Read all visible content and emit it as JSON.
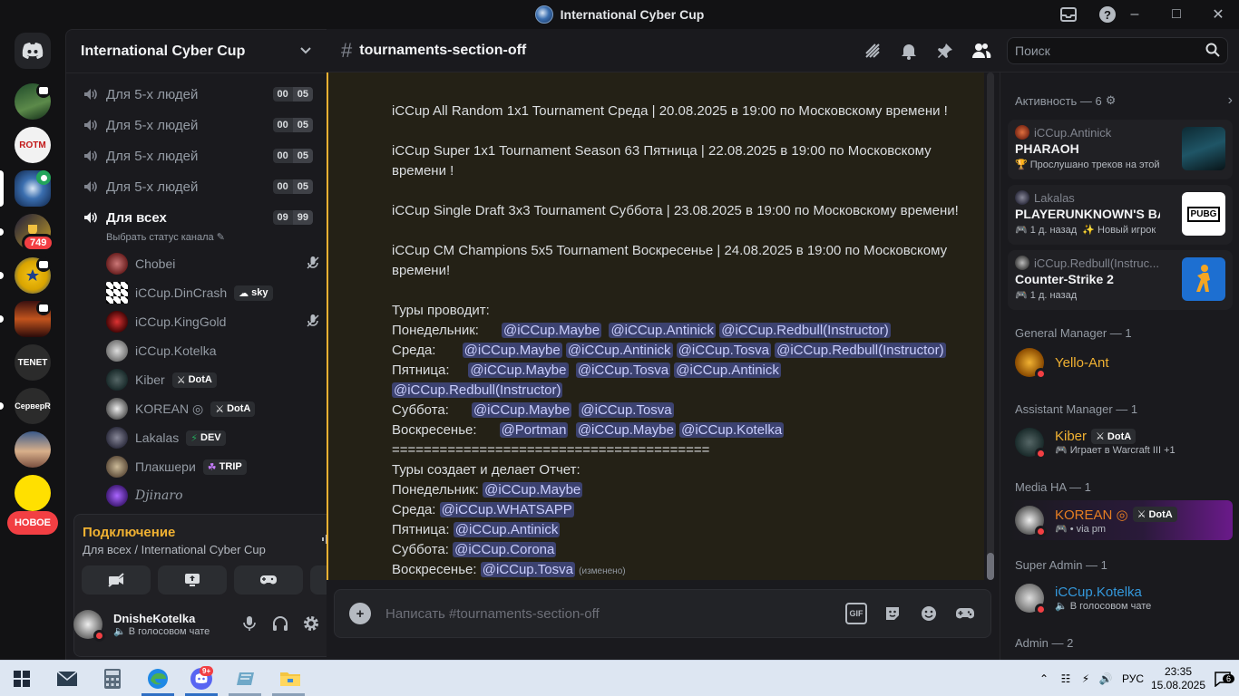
{
  "window": {
    "title": "International Cyber Cup"
  },
  "guilds": {
    "badge_count": "749",
    "new_label": "НОВОЕ",
    "labels": {
      "rotm": "ROTM",
      "tenet": "TENET",
      "serverr": "СерверR"
    }
  },
  "server": {
    "name": "International Cyber Cup"
  },
  "voice_channels": [
    {
      "name": "Для 5-х людей",
      "current": "00",
      "limit": "05"
    },
    {
      "name": "Для 5-х людей",
      "current": "00",
      "limit": "05"
    },
    {
      "name": "Для 5-х людей",
      "current": "00",
      "limit": "05"
    },
    {
      "name": "Для 5-х людей",
      "current": "00",
      "limit": "05"
    },
    {
      "name": "Для всех",
      "current": "09",
      "limit": "99"
    }
  ],
  "channel_status_prompt": "Выбрать статус канала",
  "voice_users": [
    {
      "name": "Chobei",
      "tag": "",
      "muted": true
    },
    {
      "name": "iCCup.DinCrash",
      "tag": "sky",
      "muted": false
    },
    {
      "name": "iCCup.KingGold",
      "tag": "",
      "muted": true
    },
    {
      "name": "iCCup.Kotelka",
      "tag": "",
      "muted": false
    },
    {
      "name": "Kiber",
      "tag": "DotA",
      "muted": false
    },
    {
      "name": "KOREAN ◎",
      "tag": "DotA",
      "muted": false
    },
    {
      "name": "Lakalas",
      "tag": "DEV",
      "muted": false
    },
    {
      "name": "Плакшери",
      "tag": "TRIP",
      "muted": false
    },
    {
      "name": "Djinaro",
      "tag": "",
      "muted": false
    }
  ],
  "voice_panel": {
    "status": "Подключение",
    "location": "Для всех / International Cyber Cup"
  },
  "user_panel": {
    "name": "DnisheKotelka",
    "status": "В голосовом чате"
  },
  "channel": {
    "name": "tournaments-section-off",
    "composer_placeholder": "Написать #tournaments-section-off"
  },
  "search": {
    "placeholder": "Поиск"
  },
  "message": {
    "tournaments": [
      "iCCup All Random 1x1 Tournament Среда | 20.08.2025 в 19:00 по Московскому времени !",
      "iCCup Super 1x1 Tournament Season 63 Пятница | 22.08.2025 в 19:00 по Московскому",
      "времени !",
      "iCCup Single Draft 3x3 Tournament Суббота | 23.08.2025 в 19:00 по Московскому времени!",
      "iCCup CM Champions 5x5 Tournament Воскресенье | 24.08.2025 в 19:00 по Московскому",
      "времени!"
    ],
    "hosts_title": "Туры проводит:",
    "hosts": [
      {
        "day": "Понедельник:",
        "mentions": [
          "@iCCup.Maybe",
          "@iCCup.Antinick",
          "@iCCup.Redbull(Instructor)"
        ]
      },
      {
        "day": "Среда:",
        "mentions": [
          "@iCCup.Maybe",
          "@iCCup.Antinick",
          "@iCCup.Tosva",
          "@iCCup.Redbull(Instructor)"
        ]
      },
      {
        "day": "Пятница:",
        "mentions": [
          "@iCCup.Maybe",
          "@iCCup.Tosva",
          "@iCCup.Antinick"
        ]
      },
      {
        "day": "",
        "mentions": [
          "@iCCup.Redbull(Instructor)"
        ]
      },
      {
        "day": "Суббота:",
        "mentions": [
          "@iCCup.Maybe",
          "@iCCup.Tosva"
        ]
      },
      {
        "day": "Воскресенье:",
        "mentions": [
          "@Portman",
          "@iCCup.Maybe",
          "@iCCup.Kotelka"
        ]
      }
    ],
    "separator": "========================================",
    "reports_title": "Туры создает и делает Отчет:",
    "reports": [
      {
        "day": "Понедельник:",
        "mention": "@iCCup.Maybe"
      },
      {
        "day": "Среда:",
        "mention": "@iCCup.WHATSAPP"
      },
      {
        "day": "Пятница:",
        "mention": "@iCCup.Antinick"
      },
      {
        "day": "Суббота:",
        "mention": "@iCCup.Corona"
      },
      {
        "day": "Воскресенье:",
        "mention": "@iCCup.Tosva"
      }
    ],
    "edited": "(изменено)"
  },
  "activity": {
    "title": "Активность — 6",
    "cards": [
      {
        "user": "iCCup.Antinick",
        "game": "PHARAOH",
        "detail": "Прослушано треков на этой"
      },
      {
        "user": "Lakalas",
        "game": "PLAYERUNKNOWN'S BAT...",
        "detail": "1 д. назад",
        "detail2": "Новый игрок"
      },
      {
        "user": "iCCup.Redbull(Instruc...",
        "game": "Counter-Strike 2",
        "detail": "1 д. назад"
      }
    ]
  },
  "member_groups": [
    {
      "title": "General Manager — 1",
      "members": [
        {
          "name": "Yello-Ant",
          "sub": "",
          "tag": ""
        }
      ]
    },
    {
      "title": "Assistant Manager — 1",
      "members": [
        {
          "name": "Kiber",
          "sub": "Играет в Warcraft III",
          "sub_extra": "+1",
          "tag": "DotA"
        }
      ]
    },
    {
      "title": "Media HA — 1",
      "members": [
        {
          "name": "KOREAN ◎",
          "sub": "• via pm",
          "tag": "DotA"
        }
      ]
    },
    {
      "title": "Super Admin — 1",
      "members": [
        {
          "name": "iCCup.Kotelka",
          "sub": "В голосовом чате",
          "tag": ""
        }
      ]
    },
    {
      "title": "Admin — 2",
      "members": []
    }
  ],
  "colors": {
    "accent_yellow": "#f0b132",
    "mention_bg": "#3c4270",
    "danger": "#f23f43",
    "green": "#23a55a"
  },
  "taskbar": {
    "lang": "РУС",
    "time": "23:35",
    "date": "15.08.2025",
    "notif_count": "6",
    "discord_badge": "9+"
  }
}
